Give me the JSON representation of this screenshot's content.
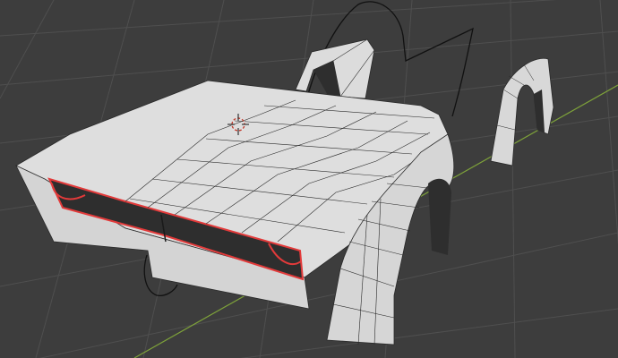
{
  "viewport": {
    "background_color": "#3d3d3d",
    "grid_color": "#4f4f4f",
    "x_axis_color": "#b04040",
    "y_axis_color": "#7ea23a",
    "mesh_fill_color": "#dcdcdc",
    "mesh_edge_color": "#2a2a2a",
    "panel_color": "#2e2e2e",
    "accent_trim_color": "#e23a3a",
    "annotation_color": "#111111",
    "cursor_color": "#e8e8e8"
  },
  "scene": {
    "objects": [
      {
        "name": "car-body-front"
      },
      {
        "name": "front-wheel-arch"
      },
      {
        "name": "rear-wheel-arch"
      },
      {
        "name": "roof-pillar"
      },
      {
        "name": "grease-pencil-sketch"
      }
    ],
    "cursor_icon": "3d-cursor-icon"
  }
}
